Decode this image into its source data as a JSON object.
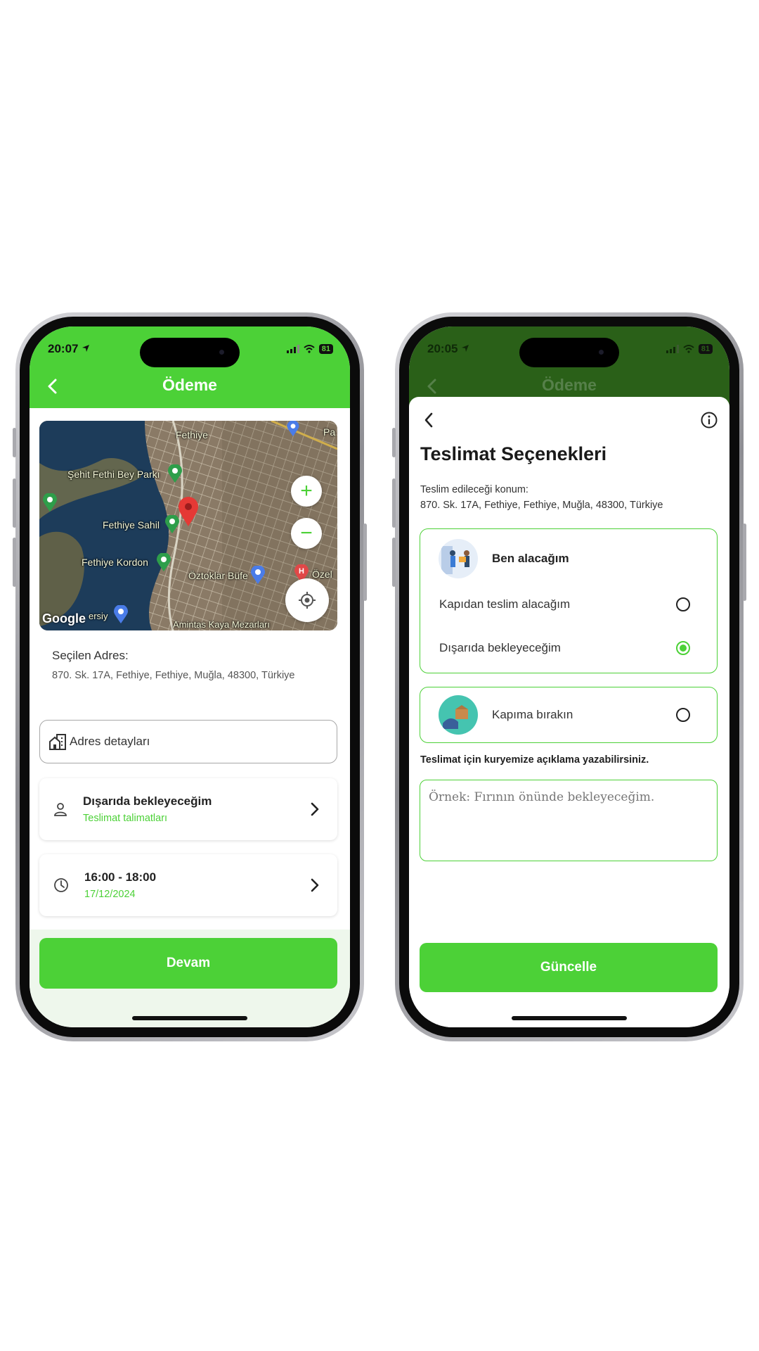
{
  "left": {
    "status": {
      "time": "20:07",
      "battery": "81"
    },
    "header_title": "Ödeme",
    "map": {
      "labels": [
        "Fethiye",
        "Şehit Fethi Bey Parkı",
        "Fethiye Sahil",
        "Fethiye Kordon",
        "Öztoklar Büfe",
        "Özel",
        "Pa",
        "Google",
        "ersiy",
        "Amintas Kaya Mezarları"
      ],
      "zoom_in": "+",
      "zoom_out": "−"
    },
    "selected_address": {
      "title": "Seçilen Adres:",
      "text": "870. Sk. 17A, Fethiye, Fethiye, Muğla, 48300, Türkiye"
    },
    "address_details_placeholder": "Adres detayları",
    "delivery_card": {
      "main": "Dışarıda bekleyeceğim",
      "sub": "Teslimat talimatları"
    },
    "time_card": {
      "main": "16:00 - 18:00",
      "sub": "17/12/2024"
    },
    "continue_button": "Devam"
  },
  "right": {
    "status": {
      "time": "20:05",
      "battery": "81"
    },
    "header_title": "Ödeme",
    "sheet_title": "Teslimat Seçenekleri",
    "location_label": "Teslim edileceği konum:",
    "location_value": "870. Sk. 17A, Fethiye, Fethiye, Muğla, 48300, Türkiye",
    "option_pickup": {
      "title": "Ben alacağım",
      "choices": [
        {
          "label": "Kapıdan teslim alacağım",
          "selected": false
        },
        {
          "label": "Dışarıda bekleyeceğim",
          "selected": true
        }
      ]
    },
    "option_leave": {
      "title": "Kapıma bırakın",
      "selected": false
    },
    "note_label": "Teslimat için kuryemize açıklama yazabilirsiniz.",
    "note_placeholder": "Örnek: Fırının önünde bekleyeceğim.",
    "update_button": "Güncelle"
  },
  "colors": {
    "accent": "#4cd137",
    "dark_header": "#2a6018",
    "bottom_bar": "#eef7ec"
  },
  "icons": [
    "back-arrow-icon",
    "info-icon",
    "location-arrow-icon",
    "signal-icon",
    "wifi-icon",
    "battery-icon",
    "building-icon",
    "person-icon",
    "clock-icon",
    "chevron-right-icon",
    "locate-icon",
    "map-pin-icon"
  ]
}
